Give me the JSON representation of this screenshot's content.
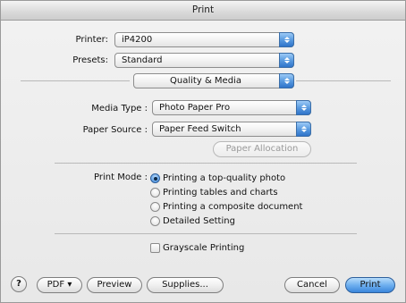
{
  "window": {
    "title": "Print"
  },
  "printer": {
    "label": "Printer:",
    "value": "iP4200"
  },
  "presets": {
    "label": "Presets:",
    "value": "Standard"
  },
  "panel": {
    "value": "Quality & Media"
  },
  "media_type": {
    "label": "Media Type :",
    "value": "Photo Paper Pro"
  },
  "paper_source": {
    "label": "Paper Source :",
    "value": "Paper Feed Switch"
  },
  "paper_allocation": {
    "label": "Paper Allocation"
  },
  "print_mode": {
    "label": "Print Mode :",
    "selected_index": 0,
    "options": [
      "Printing a top-quality photo",
      "Printing tables and charts",
      "Printing a composite document",
      "Detailed Setting"
    ]
  },
  "grayscale": {
    "label": "Grayscale Printing",
    "checked": false
  },
  "buttons": {
    "help": "?",
    "pdf": "PDF ▾",
    "preview": "Preview",
    "supplies": "Supplies...",
    "cancel": "Cancel",
    "print": "Print"
  },
  "colors": {
    "accent": "#3a86db",
    "window_bg": "#ececec"
  },
  "icons": {
    "popup_arrows": "updown-arrows-icon",
    "help": "help-icon"
  }
}
